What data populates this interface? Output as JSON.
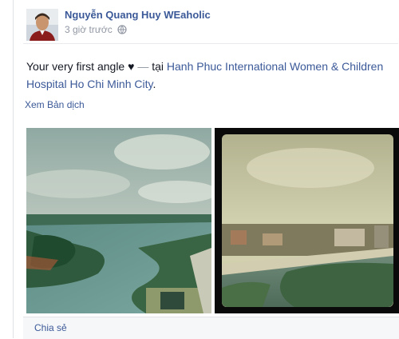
{
  "post": {
    "author": "Nguyễn Quang Huy WEaholic",
    "timestamp": "3 giờ trước",
    "privacy_icon": "globe-icon",
    "status_text": "Your very first angle ♥",
    "separator": "—",
    "location_prefix": "tại",
    "location": "Hanh Phuc International Women & Children Hospital Ho Chi Minh City",
    "location_suffix": ".",
    "translate_label": "Xem Bản dịch",
    "photos": [
      {
        "description": "river-landscape-photo"
      },
      {
        "description": "city-bridge-photo"
      }
    ],
    "share_label": "Chia sẻ"
  },
  "colors": {
    "link": "#3b5998",
    "meta": "#9197a3",
    "footer_bg": "#f6f7f9"
  }
}
